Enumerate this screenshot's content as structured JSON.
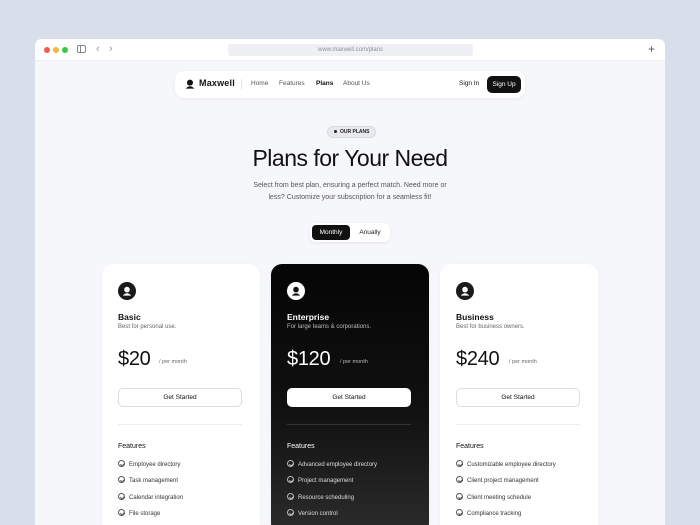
{
  "browser": {
    "url": "www.maxwell.com/plans"
  },
  "nav": {
    "brand": "Maxwell",
    "links": [
      "Home",
      "Features",
      "Plans",
      "About Us"
    ],
    "active": "Plans",
    "sign_in": "Sign In",
    "sign_up": "Sign Up"
  },
  "hero": {
    "pill": "OUR PLANS",
    "title": "Plans for Your Need",
    "subtitle_line1": "Select from best plan, ensuring a perfect match. Need more or",
    "subtitle_line2": "less? Customize your subscription for a seamless fit!"
  },
  "billing_toggle": {
    "options": [
      "Monthly",
      "Anually"
    ],
    "selected": "Monthly"
  },
  "plans": [
    {
      "name": "Basic",
      "desc": "Best for personal use.",
      "price": "$20",
      "period": "/ per month",
      "cta": "Get Started",
      "features_title": "Features",
      "features": [
        "Employee directory",
        "Task management",
        "Calendar integration",
        "File storage"
      ]
    },
    {
      "name": "Enterprise",
      "desc": "For large teams & corporations.",
      "price": "$120",
      "period": "/ per month",
      "cta": "Get Started",
      "features_title": "Features",
      "features": [
        "Advanced employee directory",
        "Project management",
        "Resource scheduling",
        "Version control"
      ]
    },
    {
      "name": "Business",
      "desc": "Best for business owners.",
      "price": "$240",
      "period": "/ per month",
      "cta": "Get Started",
      "features_title": "Features",
      "features": [
        "Customizable employee directory",
        "Client project management",
        "Client meeting schedule",
        "Compliance tracking"
      ]
    }
  ],
  "colors": {
    "accent": "#111111",
    "page_bg": "#d9dfea",
    "content_bg": "#f6f7fb"
  }
}
